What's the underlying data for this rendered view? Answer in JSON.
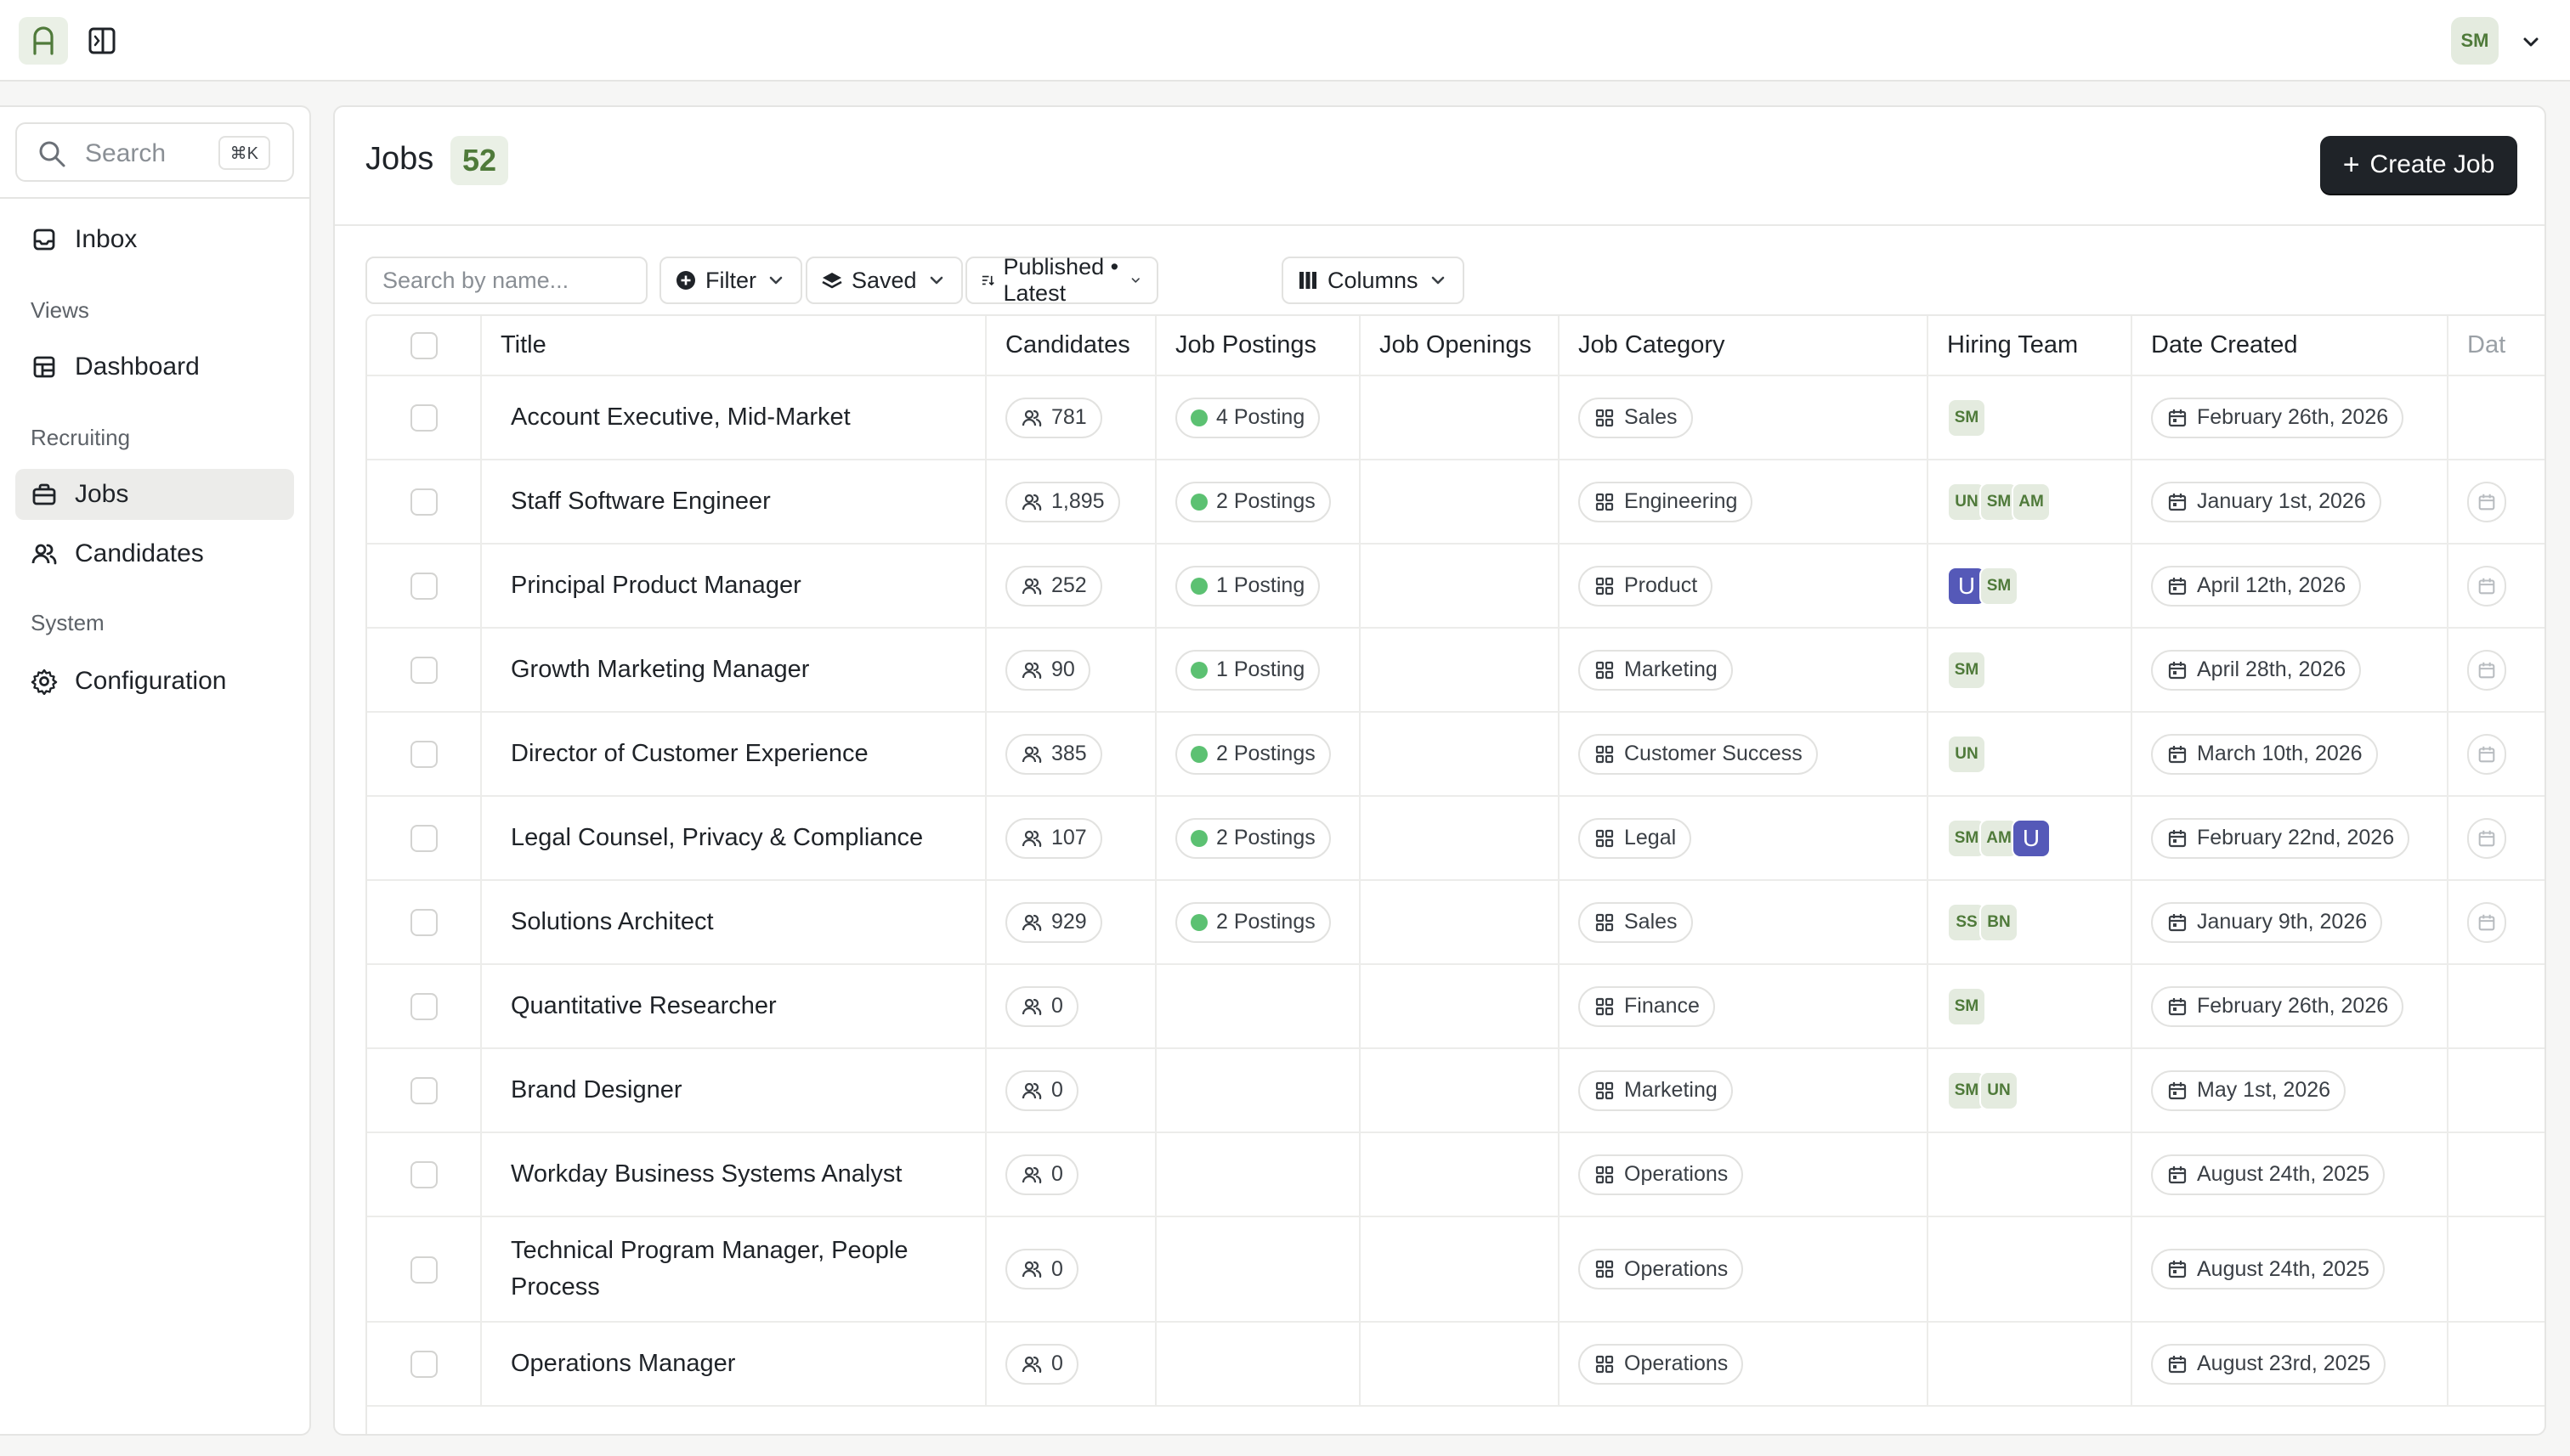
{
  "app": {
    "logo_letter": "A",
    "user_initials": "SM"
  },
  "sidebar": {
    "search_placeholder": "Search",
    "search_shortcut": "⌘K",
    "inbox_label": "Inbox",
    "sections": {
      "views": "Views",
      "recruiting": "Recruiting",
      "system": "System"
    },
    "items": {
      "dashboard": "Dashboard",
      "jobs": "Jobs",
      "candidates": "Candidates",
      "configuration": "Configuration"
    },
    "active_item": "Jobs"
  },
  "main": {
    "title": "Jobs",
    "count": "52",
    "create_button": "Create Job"
  },
  "toolbar": {
    "search_placeholder": "Search by name...",
    "filter_label": "Filter",
    "saved_label": "Saved",
    "sort_label": "Published • Latest",
    "columns_label": "Columns"
  },
  "table": {
    "columns": [
      "Title",
      "Candidates",
      "Job Postings",
      "Job Openings",
      "Job Category",
      "Hiring Team",
      "Date Created",
      "Dat"
    ],
    "rows": [
      {
        "title": "Account Executive, Mid-Market",
        "candidates": "781",
        "postings": "4 Posting",
        "category": "Sales",
        "team": [
          {
            "i": "SM",
            "c": "green"
          }
        ],
        "date": "February 26th, 2026",
        "extra": false
      },
      {
        "title": "Staff Software Engineer",
        "candidates": "1,895",
        "postings": "2 Postings",
        "category": "Engineering",
        "team": [
          {
            "i": "UN",
            "c": "green"
          },
          {
            "i": "SM",
            "c": "green"
          },
          {
            "i": "AM",
            "c": "green"
          }
        ],
        "date": "January 1st, 2026",
        "extra": true
      },
      {
        "title": "Principal Product Manager",
        "candidates": "252",
        "postings": "1 Posting",
        "category": "Product",
        "team": [
          {
            "i": "U",
            "c": "purple"
          },
          {
            "i": "SM",
            "c": "green"
          }
        ],
        "date": "April 12th, 2026",
        "extra": true
      },
      {
        "title": "Growth Marketing Manager",
        "candidates": "90",
        "postings": "1 Posting",
        "category": "Marketing",
        "team": [
          {
            "i": "SM",
            "c": "green"
          }
        ],
        "date": "April 28th, 2026",
        "extra": true
      },
      {
        "title": "Director of Customer Experience",
        "candidates": "385",
        "postings": "2 Postings",
        "category": "Customer Success",
        "team": [
          {
            "i": "UN",
            "c": "green"
          }
        ],
        "date": "March 10th, 2026",
        "extra": true
      },
      {
        "title": "Legal Counsel, Privacy & Compliance",
        "candidates": "107",
        "postings": "2 Postings",
        "category": "Legal",
        "team": [
          {
            "i": "SM",
            "c": "green"
          },
          {
            "i": "AM",
            "c": "green"
          },
          {
            "i": "U",
            "c": "purple"
          }
        ],
        "date": "February 22nd, 2026",
        "extra": true
      },
      {
        "title": "Solutions Architect",
        "candidates": "929",
        "postings": "2 Postings",
        "category": "Sales",
        "team": [
          {
            "i": "SS",
            "c": "green"
          },
          {
            "i": "BN",
            "c": "green"
          }
        ],
        "date": "January 9th, 2026",
        "extra": true
      },
      {
        "title": "Quantitative Researcher",
        "candidates": "0",
        "postings": "",
        "category": "Finance",
        "team": [
          {
            "i": "SM",
            "c": "green"
          }
        ],
        "date": "February 26th, 2026",
        "extra": false
      },
      {
        "title": "Brand Designer",
        "candidates": "0",
        "postings": "",
        "category": "Marketing",
        "team": [
          {
            "i": "SM",
            "c": "green"
          },
          {
            "i": "UN",
            "c": "green"
          }
        ],
        "date": "May 1st, 2026",
        "extra": false
      },
      {
        "title": "Workday Business Systems Analyst",
        "candidates": "0",
        "postings": "",
        "category": "Operations",
        "team": [],
        "date": "August 24th, 2025",
        "extra": false
      },
      {
        "title": "Technical Program Manager, People Process",
        "candidates": "0",
        "postings": "",
        "category": "Operations",
        "team": [],
        "date": "August 24th, 2025",
        "extra": false
      },
      {
        "title": "Operations Manager",
        "candidates": "0",
        "postings": "",
        "category": "Operations",
        "team": [],
        "date": "August 23rd, 2025",
        "extra": false
      }
    ]
  },
  "colors": {
    "accent_green": "#4f7a3a",
    "accent_green_bg": "#eaf0e6",
    "posting_dot": "#5cc172",
    "avatar_purple": "#5559b8",
    "primary_button": "#1f2328"
  }
}
